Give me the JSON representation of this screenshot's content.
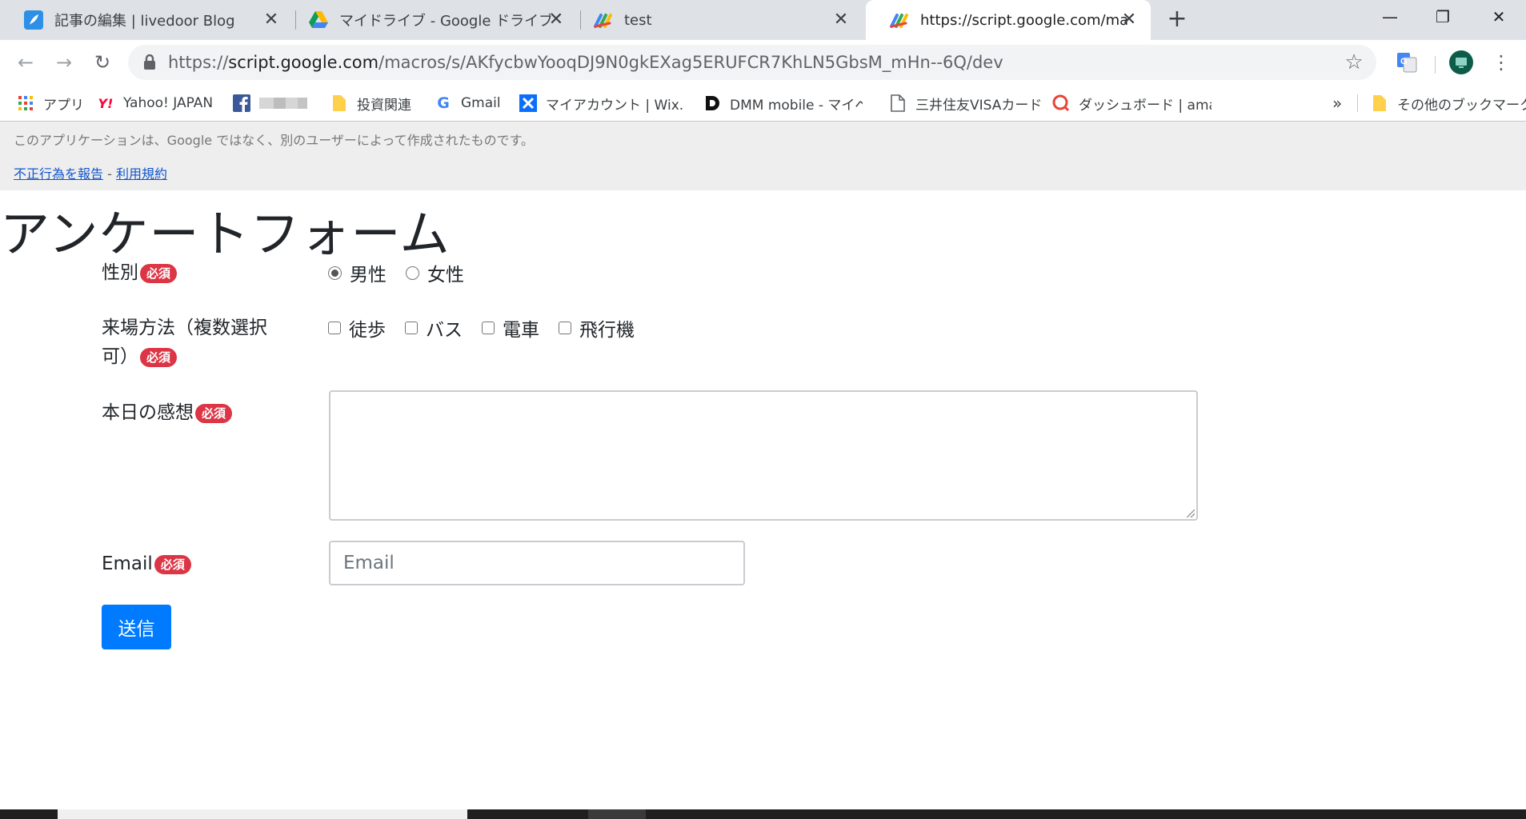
{
  "tabs": [
    {
      "title": "記事の編集 | livedoor Blog",
      "icon": "feather-icon",
      "color": "#2d8fe6"
    },
    {
      "title": "マイドライブ - Google ドライブ",
      "icon": "google-drive-icon"
    },
    {
      "title": "test",
      "icon": "apps-script-icon"
    },
    {
      "title": "https://script.google.com/macros/s/AKfycbw",
      "icon": "apps-script-icon",
      "active": true
    }
  ],
  "address_bar": {
    "scheme": "https://",
    "host": "script.google.com",
    "path": "/macros/s/AKfycbwYooqDJ9N0gkEXag5ERUFCR7KhLN5GbsM_mHn--6Q/dev"
  },
  "bookmarks": [
    {
      "label": "アプリ",
      "icon": "apps-grid-icon"
    },
    {
      "label": "Yahoo! JAPAN",
      "icon": "yahoo-icon"
    },
    {
      "label": "",
      "icon": "facebook-icon"
    },
    {
      "label": "投資関連",
      "icon": "folder-icon"
    },
    {
      "label": "Gmail",
      "icon": "google-icon"
    },
    {
      "label": "マイアカウント | Wix.com",
      "icon": "wix-icon"
    },
    {
      "label": "DMM mobile - マイペ",
      "icon": "dmm-icon"
    },
    {
      "label": "三井住友VISAカード",
      "icon": "page-icon"
    },
    {
      "label": "ダッシュボード | amazon",
      "icon": "search-circle-icon"
    },
    {
      "label": "»",
      "icon": "chevron-double-icon"
    },
    {
      "label": "その他のブックマーク",
      "icon": "folder-icon"
    }
  ],
  "banner": {
    "notice": "このアプリケーションは、Google ではなく、別のユーザーによって作成されたものです。",
    "report_link": "不正行為を報告",
    "separator": " - ",
    "terms_link": "利用規約"
  },
  "form": {
    "title": "アンケートフォーム",
    "required_badge": "必須",
    "gender": {
      "label": "性別",
      "options": [
        {
          "label": "男性",
          "checked": true
        },
        {
          "label": "女性",
          "checked": false
        }
      ]
    },
    "transport": {
      "label_line1": "来場方法（複数選択",
      "label_line2": "可）",
      "options": [
        "徒歩",
        "バス",
        "電車",
        "飛行機"
      ]
    },
    "impression": {
      "label": "本日の感想",
      "value": ""
    },
    "email": {
      "label": "Email",
      "placeholder": "Email",
      "value": ""
    },
    "submit_label": "送信"
  },
  "colors": {
    "required_badge": "#dc3545",
    "submit_button": "#007bff",
    "banner_bg": "#eeeeee",
    "link": "#1155cc"
  }
}
